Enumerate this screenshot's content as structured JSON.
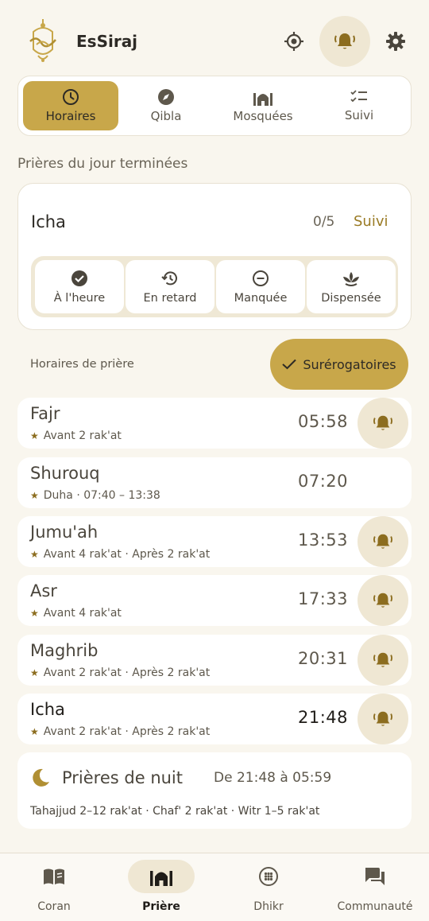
{
  "app": {
    "name": "EsSiraj"
  },
  "colors": {
    "accent": "#c8a74a",
    "accent_dark": "#8c6d1f",
    "pill_bg": "#efe7d3",
    "background": "#f9f6ee"
  },
  "tabs": [
    {
      "label": "Horaires",
      "icon": "clock-icon",
      "active": true
    },
    {
      "label": "Qibla",
      "icon": "compass-icon",
      "active": false
    },
    {
      "label": "Mosquées",
      "icon": "mosque-icon",
      "active": false
    },
    {
      "label": "Suivi",
      "icon": "checklist-icon",
      "active": false
    }
  ],
  "status": {
    "section_note": "Prières du jour terminées",
    "prayer": "Icha",
    "count": "0/5",
    "link": "Suivi",
    "options": [
      {
        "label": "À l'heure",
        "icon": "check-circle-icon"
      },
      {
        "label": "En retard",
        "icon": "history-icon"
      },
      {
        "label": "Manquée",
        "icon": "minus-circle-icon"
      },
      {
        "label": "Dispensée",
        "icon": "lotus-icon"
      }
    ]
  },
  "times": {
    "label": "Horaires de prière",
    "supererogatory_button": "Surérogatoires"
  },
  "prayers": [
    {
      "name": "Fajr",
      "sub": "Avant 2 rak'at",
      "time": "05:58",
      "bell": true
    },
    {
      "name": "Shurouq",
      "sub": "Duha · 07:40 – 13:38",
      "time": "07:20",
      "bell": false
    },
    {
      "name": "Jumu'ah",
      "sub": "Avant 4 rak'at · Après 2 rak'at",
      "time": "13:53",
      "bell": true
    },
    {
      "name": "Asr",
      "sub": "Avant 4 rak'at",
      "time": "17:33",
      "bell": true
    },
    {
      "name": "Maghrib",
      "sub": "Avant 2 rak'at · Après 2 rak'at",
      "time": "20:31",
      "bell": true
    },
    {
      "name": "Icha",
      "sub": "Avant 2 rak'at · Après 2 rak'at",
      "time": "21:48",
      "bell": true
    }
  ],
  "night": {
    "title": "Prières de nuit",
    "range": "De 21:48 à 05:59",
    "detail": "Tahajjud 2–12 rak'at · Chaf' 2 rak'at · Witr 1–5 rak'at"
  },
  "bottom_nav": [
    {
      "label": "Coran",
      "icon": "book-icon",
      "active": false
    },
    {
      "label": "Prière",
      "icon": "mosque-icon",
      "active": true
    },
    {
      "label": "Dhikr",
      "icon": "beads-icon",
      "active": false
    },
    {
      "label": "Communauté",
      "icon": "chat-icon",
      "active": false
    }
  ]
}
